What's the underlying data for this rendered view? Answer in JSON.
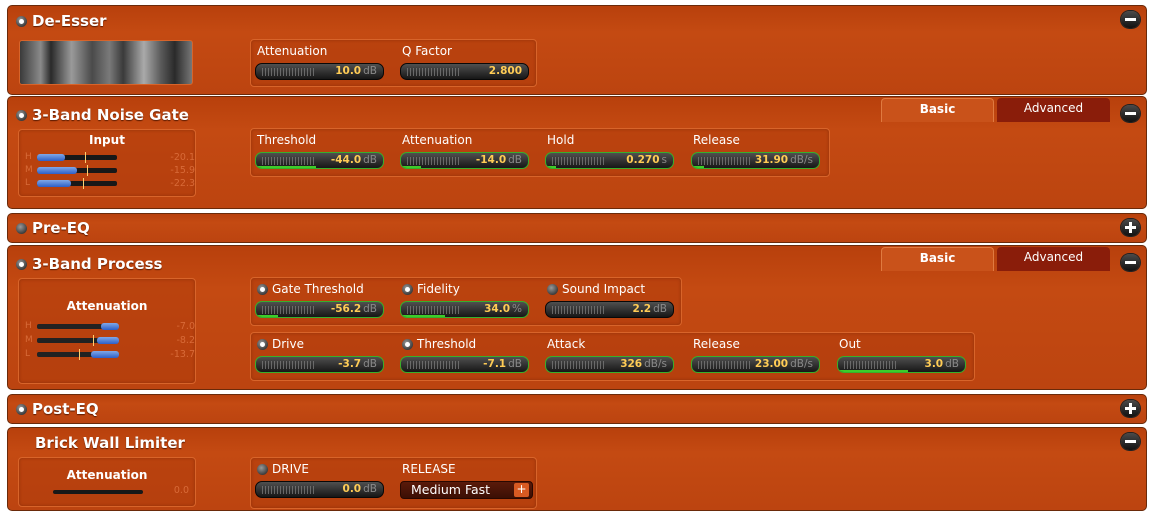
{
  "deesser": {
    "title": "De-Esser",
    "controls": [
      {
        "label": "Attenuation",
        "value": "10.0",
        "unit": "dB"
      },
      {
        "label": "Q Factor",
        "value": "2.800",
        "unit": ""
      }
    ]
  },
  "noise_gate": {
    "title": "3-Band Noise Gate",
    "tabs": [
      "Basic",
      "Advanced"
    ],
    "input_label": "Input",
    "meters": [
      {
        "band": "H",
        "value": "-20.1"
      },
      {
        "band": "M",
        "value": "-15.9"
      },
      {
        "band": "L",
        "value": "-22.3"
      }
    ],
    "controls": [
      {
        "label": "Threshold",
        "value": "-44.0",
        "unit": "dB"
      },
      {
        "label": "Attenuation",
        "value": "-14.0",
        "unit": "dB"
      },
      {
        "label": "Hold",
        "value": "0.270",
        "unit": "s"
      },
      {
        "label": "Release",
        "value": "31.90",
        "unit": "dB/s"
      }
    ]
  },
  "pre_eq": {
    "title": "Pre-EQ"
  },
  "band_process": {
    "title": "3-Band Process",
    "tabs": [
      "Basic",
      "Advanced"
    ],
    "attenuation_label": "Attenuation",
    "meters": [
      {
        "band": "H",
        "value": "-7.0"
      },
      {
        "band": "M",
        "value": "-8.2"
      },
      {
        "band": "L",
        "value": "-13.7"
      }
    ],
    "row1": [
      {
        "label": "Gate Threshold",
        "value": "-56.2",
        "unit": "dB"
      },
      {
        "label": "Fidelity",
        "value": "34.0",
        "unit": "%"
      },
      {
        "label": "Sound Impact",
        "value": "2.2",
        "unit": "dB"
      }
    ],
    "row2": [
      {
        "label": "Drive",
        "value": "-3.7",
        "unit": "dB"
      },
      {
        "label": "Threshold",
        "value": "-7.1",
        "unit": "dB"
      },
      {
        "label": "Attack",
        "value": "326",
        "unit": "dB/s"
      },
      {
        "label": "Release",
        "value": "23.00",
        "unit": "dB/s"
      },
      {
        "label": "Out",
        "value": "3.0",
        "unit": "dB"
      }
    ]
  },
  "post_eq": {
    "title": "Post-EQ"
  },
  "limiter": {
    "title": "Brick Wall Limiter",
    "attenuation_label": "Attenuation",
    "attenuation_value": "0.0",
    "drive": {
      "label": "DRIVE",
      "value": "0.0",
      "unit": "dB"
    },
    "release": {
      "label": "RELEASE",
      "value": "Medium Fast",
      "arrow": "+"
    }
  }
}
